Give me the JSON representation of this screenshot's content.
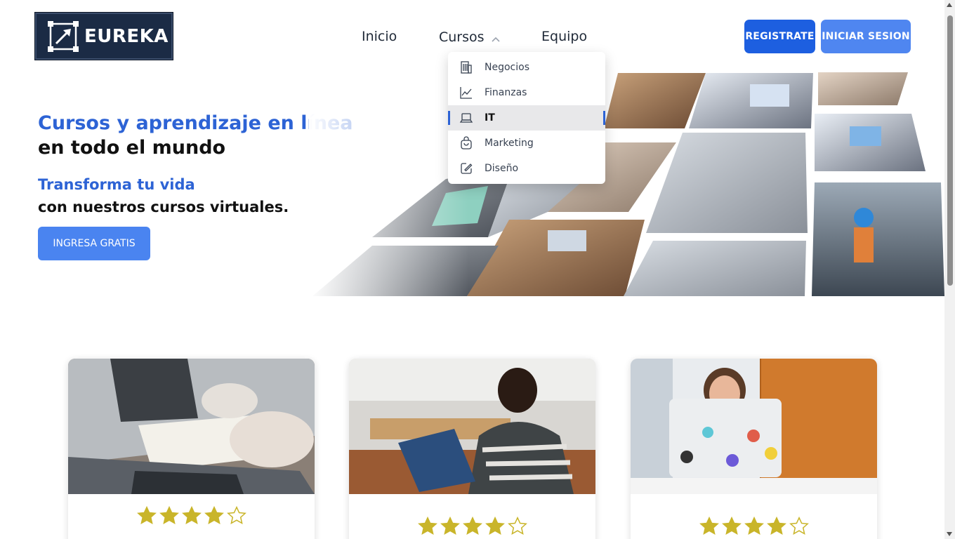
{
  "brand": {
    "name": "EUREKA",
    "logo_icon": "arrow-up-right-square-icon"
  },
  "nav": {
    "items": [
      {
        "label": "Inicio"
      },
      {
        "label": "Cursos",
        "icon": "chevron-up-icon"
      },
      {
        "label": "Equipo"
      }
    ]
  },
  "actions": {
    "register_label": "REGISTRATE",
    "login_label": "INICIAR SESION"
  },
  "dropdown": {
    "items": [
      {
        "label": "Negocios",
        "icon": "building-icon",
        "active": false
      },
      {
        "label": "Finanzas",
        "icon": "line-chart-icon",
        "active": false
      },
      {
        "label": "IT",
        "icon": "laptop-icon",
        "active": true
      },
      {
        "label": "Marketing",
        "icon": "shopping-bag-icon",
        "active": false
      },
      {
        "label": "Diseño",
        "icon": "design-pencil-icon",
        "active": false
      }
    ]
  },
  "hero": {
    "title_line1": "Cursos y aprendizaje en línea",
    "title_line2": "en todo el mundo",
    "subtitle_line1": "Transforma tu vida",
    "subtitle_line2": "con nuestros cursos virtuales.",
    "cta_label": "INGRESA GRATIS"
  },
  "cards": [
    {
      "image": "laptop-meeting-photo",
      "rating": 4,
      "max_rating": 5
    },
    {
      "image": "woman-laptop-kitchen-photo",
      "rating": 4,
      "max_rating": 5
    },
    {
      "image": "woman-stickered-laptop-photo",
      "rating": 4,
      "max_rating": 5
    }
  ],
  "colors": {
    "accent": "#2d63d5",
    "register_bg": "#1d5fe0",
    "login_bg": "#4f86f0",
    "star": "#c9b52a",
    "logo_bg": "#1b2b45"
  }
}
